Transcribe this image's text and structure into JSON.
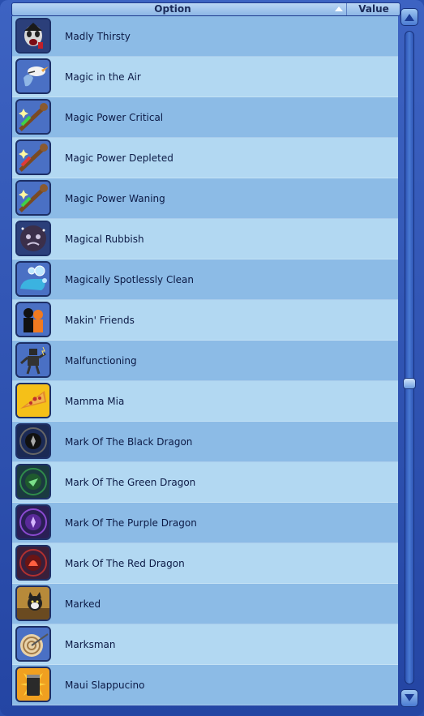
{
  "header": {
    "option_label": "Option",
    "value_label": "Value",
    "sort_icon": "sort-ascending-icon"
  },
  "rows": [
    {
      "label": "Madly Thirsty",
      "icon": "vampire-face-icon"
    },
    {
      "label": "Magic in the Air",
      "icon": "stork-bundle-icon"
    },
    {
      "label": "Magic Power Critical",
      "icon": "magic-wand-icon"
    },
    {
      "label": "Magic Power Depleted",
      "icon": "magic-wand-icon"
    },
    {
      "label": "Magic Power Waning",
      "icon": "magic-wand-icon"
    },
    {
      "label": "Magical Rubbish",
      "icon": "angry-trash-ball-icon"
    },
    {
      "label": "Magically Spotlessly Clean",
      "icon": "soap-bubbles-icon"
    },
    {
      "label": "Makin' Friends",
      "icon": "friends-silhouette-icon"
    },
    {
      "label": "Malfunctioning",
      "icon": "robot-icon"
    },
    {
      "label": "Mamma Mia",
      "icon": "pizza-slice-icon"
    },
    {
      "label": "Mark Of The Black Dragon",
      "icon": "black-dragon-emblem-icon"
    },
    {
      "label": "Mark Of The Green Dragon",
      "icon": "green-dragon-emblem-icon"
    },
    {
      "label": "Mark Of The Purple Dragon",
      "icon": "purple-dragon-emblem-icon"
    },
    {
      "label": "Mark Of The Red Dragon",
      "icon": "red-dragon-emblem-icon"
    },
    {
      "label": "Marked",
      "icon": "cat-icon"
    },
    {
      "label": "Marksman",
      "icon": "target-icon"
    },
    {
      "label": "Maui Slappucino",
      "icon": "coffee-cup-icon"
    }
  ],
  "colors": {
    "row_odd": "#8cbbe6",
    "row_even": "#b2d8f2",
    "frame": "#2a4fae",
    "text": "#0c1a45"
  }
}
